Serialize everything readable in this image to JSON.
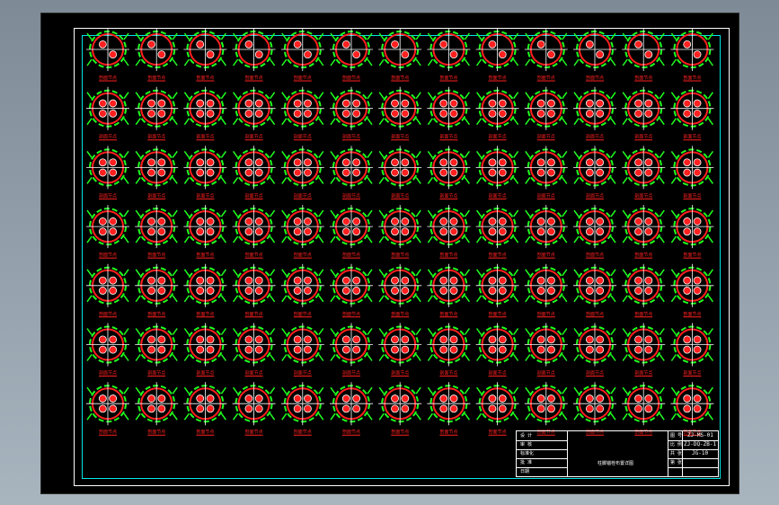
{
  "drawing": {
    "rows": 7,
    "cols": 13,
    "detail_label": "剖面节点",
    "colors": {
      "background": "#000000",
      "outer_frame": "#ffffff",
      "inner_frame": "#00e5e5",
      "circle": "#ff2020",
      "dimension": "#20ff20",
      "centerline": "#ffffff",
      "label": "#ff2020"
    }
  },
  "title_block": {
    "left_rows": [
      "设 计",
      "审 核",
      "标准化",
      "批 准",
      "日期"
    ],
    "center_title": "柱脚锚栓布置详图",
    "right_labels": [
      "图 号",
      "比 例",
      "共 张",
      "第 张"
    ],
    "right_values": [
      "ZJ-MS-01",
      "ZJ-DQ-ZB-1",
      "",
      "JG-10"
    ]
  }
}
